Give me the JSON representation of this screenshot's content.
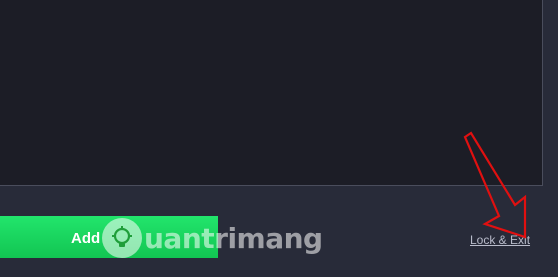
{
  "actions": {
    "add_label": "Add",
    "lock_exit_label": "Lock & Exit"
  },
  "watermark": {
    "text": "uantrimang"
  },
  "colors": {
    "background": "#282b39",
    "panel": "#1c1d26",
    "add_button": "#18d960",
    "link": "#b9bccb",
    "arrow": "#e01010"
  },
  "icons": {
    "watermark_logo": "lightbulb-icon",
    "annotation": "red-arrow"
  }
}
